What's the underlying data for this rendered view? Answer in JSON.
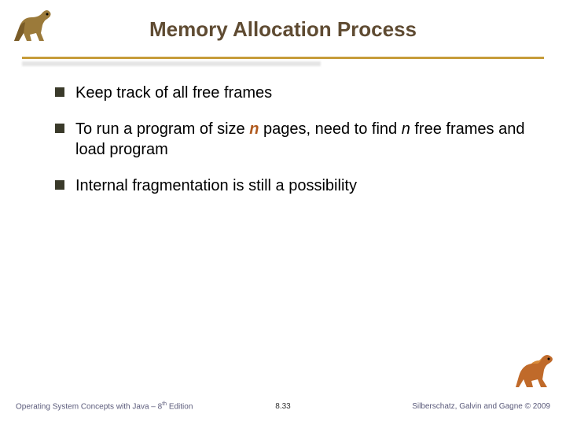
{
  "header": {
    "title": "Memory Allocation Process"
  },
  "bullets": [
    {
      "html": "Keep track of all free frames"
    },
    {
      "html": "To run a program of size <span class='it accent'>n</span> pages, need to find <span class='it'>n</span> free frames and load program"
    },
    {
      "html": "Internal fragmentation is still a possibility"
    }
  ],
  "footer": {
    "left_html": "Operating System Concepts with Java – 8<sup>th</sup> Edition",
    "center": "8.33",
    "right": "Silberschatz, Galvin and Gagne © 2009"
  },
  "icons": {
    "dino_left": "dinosaur-icon",
    "dino_right": "dinosaur-icon"
  }
}
